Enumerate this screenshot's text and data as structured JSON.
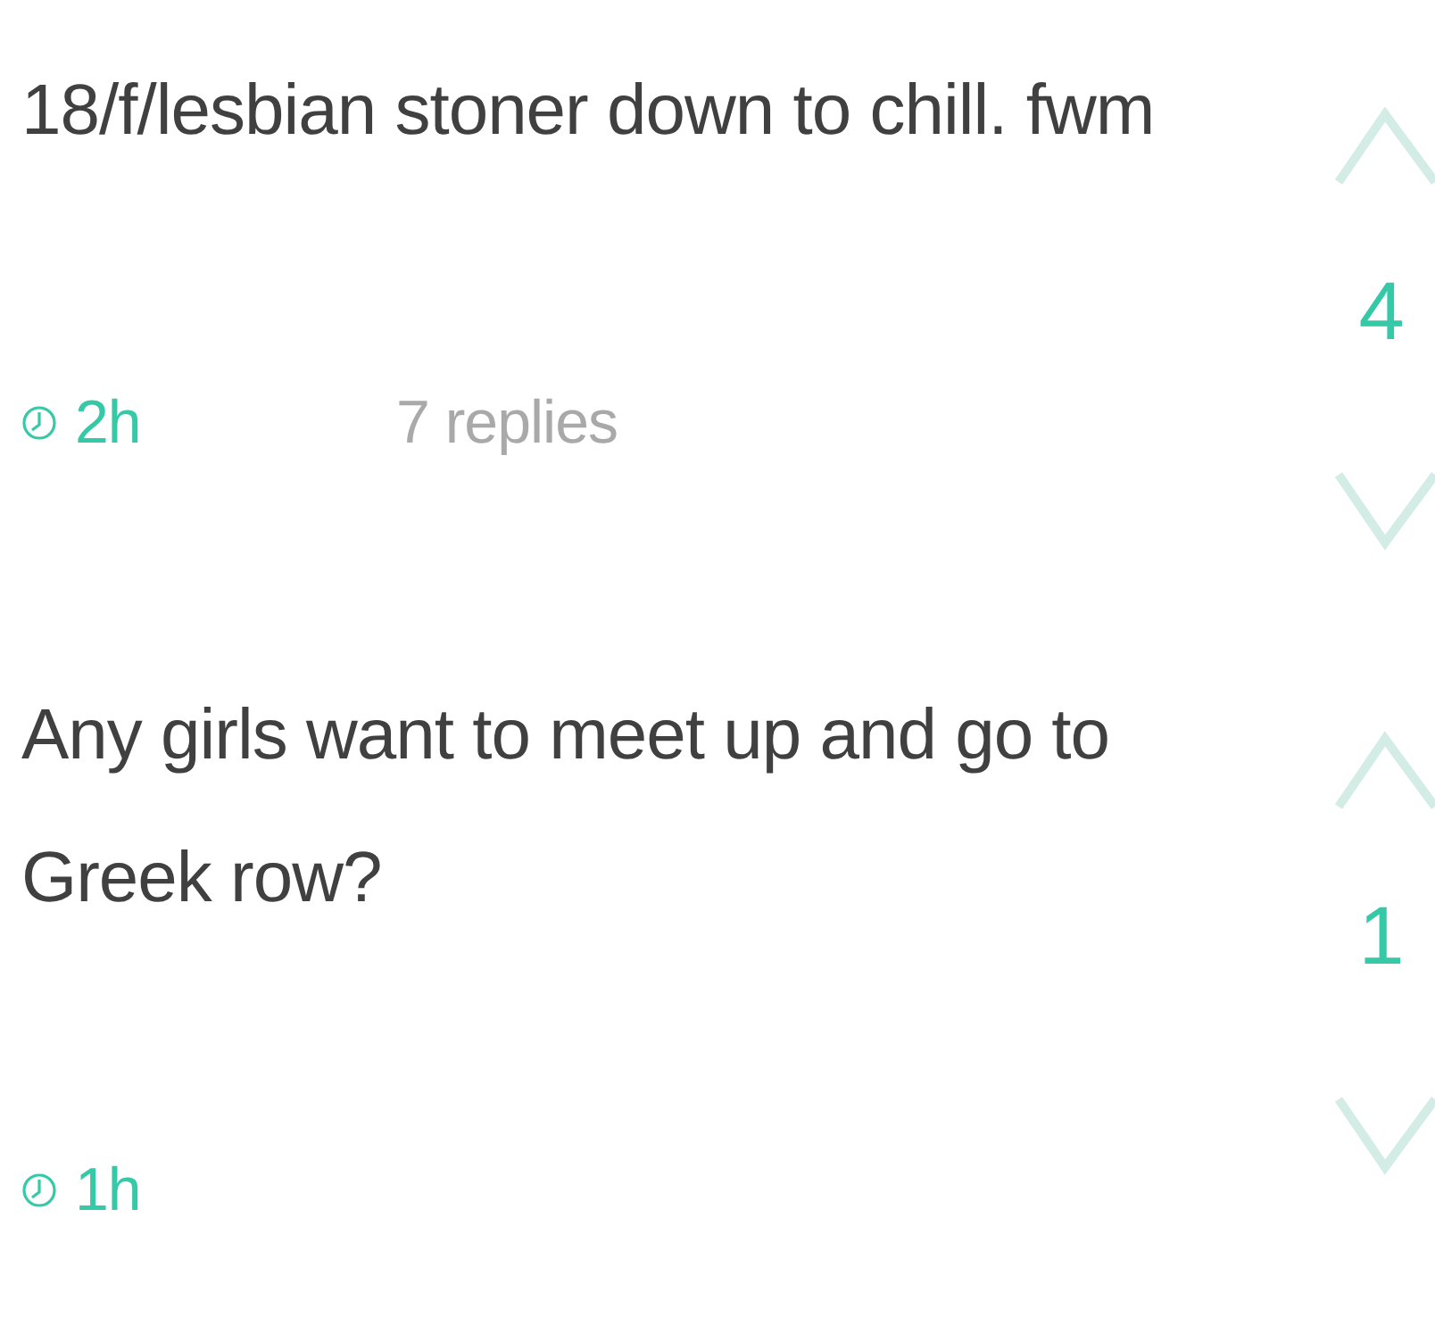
{
  "posts": [
    {
      "text": "18/f/lesbian stoner down to chill. fwm",
      "time": "2h",
      "replies": "7 replies",
      "votes": "4"
    },
    {
      "text": "Any girls want to meet up and go to Greek row?",
      "time": "1h",
      "votes": "1"
    }
  ]
}
